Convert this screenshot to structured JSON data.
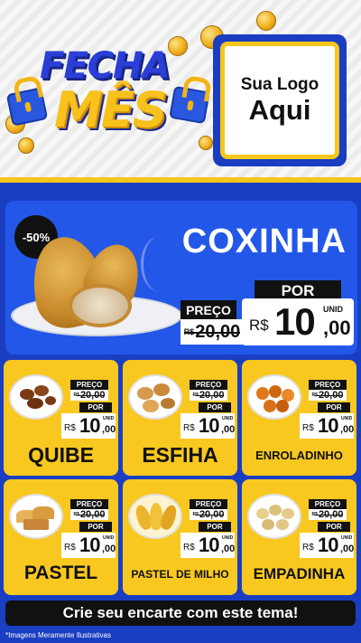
{
  "header": {
    "title_line1": "FECHA",
    "title_line2": "MÊS",
    "logo_line1": "Sua Logo",
    "logo_line2": "Aqui"
  },
  "featured": {
    "discount": "-50%",
    "name": "COXINHA",
    "preco_label": "PREÇO",
    "por_label": "POR",
    "old_currency": "R$",
    "old_price": "20,00",
    "currency": "R$",
    "price_int": "10",
    "price_dec": ",00",
    "unit": "UNID"
  },
  "products": [
    {
      "name": "QUIBE",
      "preco_label": "PREÇO",
      "old_currency": "R$",
      "old_price": "20,00",
      "por_label": "POR",
      "currency": "R$",
      "price_int": "10",
      "price_dec": ",00",
      "unit": "UNID"
    },
    {
      "name": "ESFIHA",
      "preco_label": "PREÇO",
      "old_currency": "R$",
      "old_price": "20,00",
      "por_label": "POR",
      "currency": "R$",
      "price_int": "10",
      "price_dec": ",00",
      "unit": "UNID"
    },
    {
      "name": "ENROLADINHO",
      "preco_label": "PREÇO",
      "old_currency": "R$",
      "old_price": "20,00",
      "por_label": "POR",
      "currency": "R$",
      "price_int": "10",
      "price_dec": ",00",
      "unit": "UNID"
    },
    {
      "name": "PASTEL",
      "preco_label": "PREÇO",
      "old_currency": "R$",
      "old_price": "20,00",
      "por_label": "POR",
      "currency": "R$",
      "price_int": "10",
      "price_dec": ",00",
      "unit": "UNID"
    },
    {
      "name": "PASTEL DE MILHO",
      "preco_label": "PREÇO",
      "old_currency": "R$",
      "old_price": "20,00",
      "por_label": "POR",
      "currency": "R$",
      "price_int": "10",
      "price_dec": ",00",
      "unit": "UNID"
    },
    {
      "name": "EMPADINHA",
      "preco_label": "PREÇO",
      "old_currency": "R$",
      "old_price": "20,00",
      "por_label": "POR",
      "currency": "R$",
      "price_int": "10",
      "price_dec": ",00",
      "unit": "UNID"
    }
  ],
  "footer": {
    "cta": "Crie seu encarte com este tema!",
    "disclaimer": "*Imagens Meramente Ilustrativas"
  },
  "colors": {
    "brand_blue": "#1a3ec2",
    "card_blue": "#2357e8",
    "yellow": "#f8c820",
    "black": "#111111"
  }
}
